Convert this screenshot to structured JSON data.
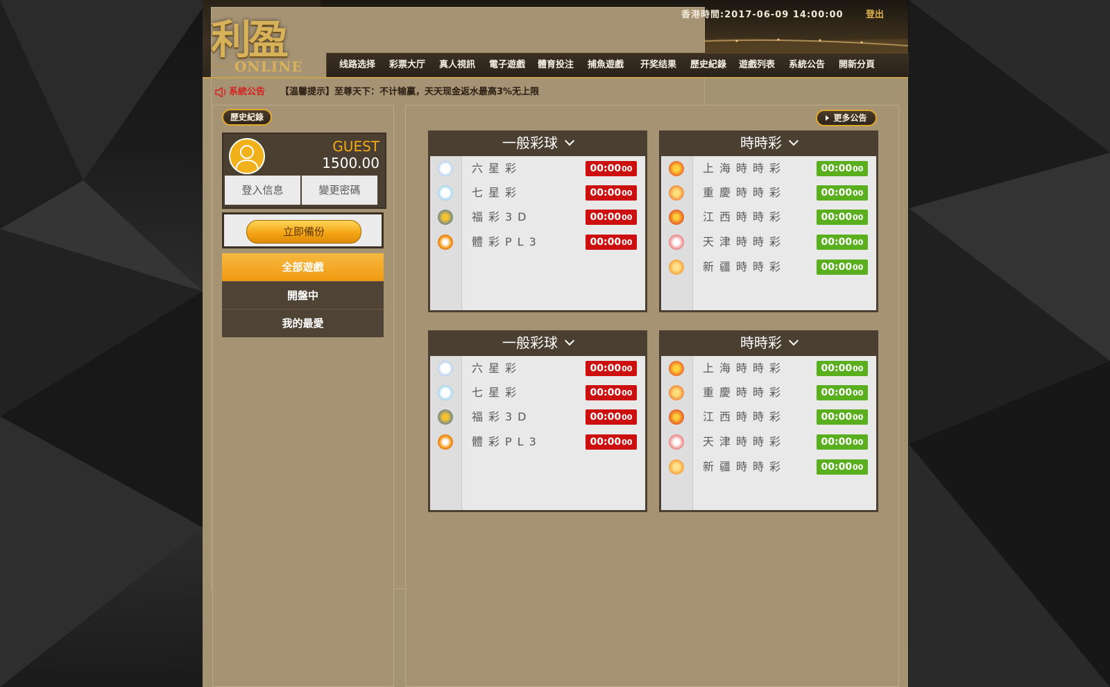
{
  "brand": {
    "logo_main": "利盈",
    "logo_sub": "ONLINE"
  },
  "header": {
    "hk_time": "香港時間:2017-06-09 14:00:00",
    "logout_label": "登出"
  },
  "nav": {
    "items": [
      "线路选择",
      "彩票大厅",
      "真人視訊",
      "電子遊戲",
      "體育投注",
      "捕魚遊戲",
      "开奖结果",
      "歷史紀錄",
      "遊戲列表",
      "系統公告",
      "開新分頁"
    ]
  },
  "notice": {
    "title": "系統公告",
    "text": "【温馨提示】至尊天下：不计输赢，天天现金返水最高3%无上限"
  },
  "sidebar": {
    "history_label": "歷史紀錄",
    "user": {
      "name": "GUEST",
      "balance": "1500.00"
    },
    "login_info_label": "登入信息",
    "change_password_label": "變更密碼",
    "backup_label": "立即備份",
    "menu": [
      {
        "label": "全部遊戲",
        "active": true
      },
      {
        "label": "開盤中",
        "active": false
      },
      {
        "label": "我的最愛",
        "active": false
      }
    ]
  },
  "main": {
    "more_notice_label": "更多公告"
  },
  "panels": [
    {
      "title": "一般彩球",
      "timer_color": "#cc1010",
      "rows": [
        {
          "name": "六星彩",
          "icon": "six-star-lottery-icon",
          "time_main": "00:00",
          "time_small": "00"
        },
        {
          "name": "七星彩",
          "icon": "seven-star-lottery-icon",
          "time_main": "00:00",
          "time_small": "00"
        },
        {
          "name": "福彩3D",
          "icon": "welfare-3d-icon",
          "time_main": "00:00",
          "time_small": "00"
        },
        {
          "name": "體彩PL3",
          "icon": "sports-pl3-icon",
          "time_main": "00:00",
          "time_small": "00"
        }
      ]
    },
    {
      "title": "時時彩",
      "timer_color": "#5aaf1e",
      "rows": [
        {
          "name": "上海時時彩",
          "icon": "shanghai-ssc-icon",
          "time_main": "00:00",
          "time_small": "00"
        },
        {
          "name": "重慶時時彩",
          "icon": "chongqing-ssc-icon",
          "time_main": "00:00",
          "time_small": "00"
        },
        {
          "name": "江西時時彩",
          "icon": "jiangxi-ssc-icon",
          "time_main": "00:00",
          "time_small": "00"
        },
        {
          "name": "天津時時彩",
          "icon": "tianjin-ssc-icon",
          "time_main": "00:00",
          "time_small": "00"
        },
        {
          "name": "新疆時時彩",
          "icon": "xinjiang-ssc-icon",
          "time_main": "00:00",
          "time_small": "00"
        }
      ]
    },
    {
      "title": "一般彩球",
      "timer_color": "#cc1010",
      "rows": [
        {
          "name": "六星彩",
          "icon": "six-star-lottery-icon",
          "time_main": "00:00",
          "time_small": "00"
        },
        {
          "name": "七星彩",
          "icon": "seven-star-lottery-icon",
          "time_main": "00:00",
          "time_small": "00"
        },
        {
          "name": "福彩3D",
          "icon": "welfare-3d-icon",
          "time_main": "00:00",
          "time_small": "00"
        },
        {
          "name": "體彩PL3",
          "icon": "sports-pl3-icon",
          "time_main": "00:00",
          "time_small": "00"
        }
      ]
    },
    {
      "title": "時時彩",
      "timer_color": "#5aaf1e",
      "rows": [
        {
          "name": "上海時時彩",
          "icon": "shanghai-ssc-icon",
          "time_main": "00:00",
          "time_small": "00"
        },
        {
          "name": "重慶時時彩",
          "icon": "chongqing-ssc-icon",
          "time_main": "00:00",
          "time_small": "00"
        },
        {
          "name": "江西時時彩",
          "icon": "jiangxi-ssc-icon",
          "time_main": "00:00",
          "time_small": "00"
        },
        {
          "name": "天津時時彩",
          "icon": "tianjin-ssc-icon",
          "time_main": "00:00",
          "time_small": "00"
        },
        {
          "name": "新疆時時彩",
          "icon": "xinjiang-ssc-icon",
          "time_main": "00:00",
          "time_small": "00"
        }
      ]
    }
  ],
  "colors": {
    "accent_gold": "#f3aa16",
    "timer_red": "#cc1010",
    "timer_green": "#5aaf1e",
    "panel_dark": "#4a3f30"
  }
}
